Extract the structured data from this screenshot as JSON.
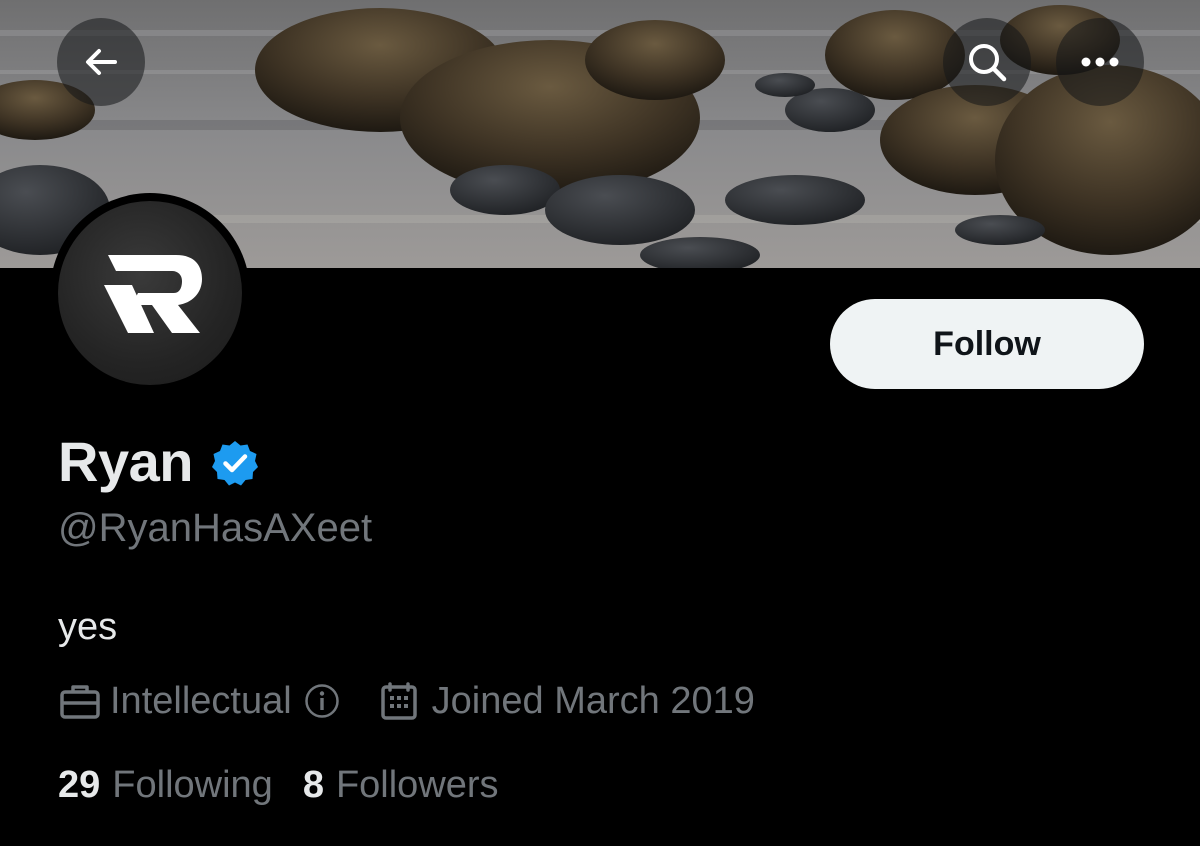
{
  "header": {
    "back_icon": "arrow-left-icon",
    "search_icon": "search-icon",
    "more_icon": "more-horizontal-icon"
  },
  "profile": {
    "display_name": "Ryan",
    "verified": true,
    "handle": "@RyanHasAXeet",
    "bio": "yes",
    "category": "Intellectual",
    "joined": "Joined March 2019",
    "following_count": "29",
    "following_label": "Following",
    "followers_count": "8",
    "followers_label": "Followers"
  },
  "actions": {
    "follow_label": "Follow"
  },
  "colors": {
    "background": "#000000",
    "primary_text": "#e7e9ea",
    "secondary_text": "#71767b",
    "verified_blue": "#1d9bf0",
    "follow_button_bg": "#eff3f4"
  }
}
